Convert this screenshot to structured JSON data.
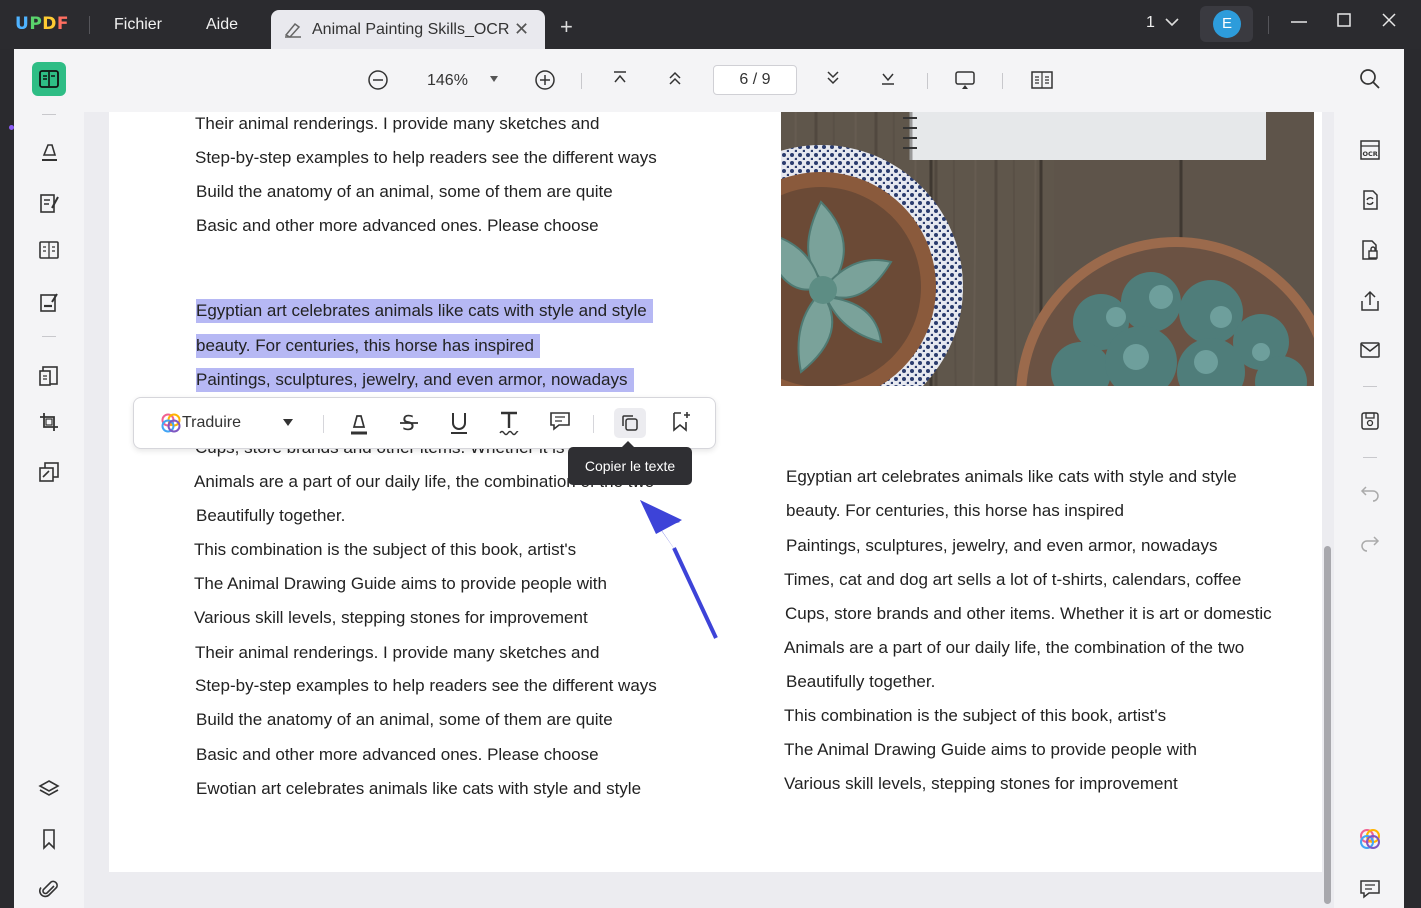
{
  "app": {
    "logo": {
      "u": "U",
      "p": "P",
      "d": "D",
      "f": "F"
    },
    "menus": [
      "Fichier",
      "Aide"
    ],
    "tab_title": "Animal Painting Skills_OCR",
    "page_selector": "1",
    "user_initial": "E"
  },
  "toolbar": {
    "zoom": "146%",
    "current_page": "6",
    "total_pages": "9",
    "page_display": "6 / 9"
  },
  "floating_toolbar": {
    "translate_label": "Traduire",
    "tooltip": "Copier le texte"
  },
  "document": {
    "left_column_top": [
      "Their animal renderings. I provide many sketches and",
      "Step-by-step examples to help readers see the different ways",
      "Build the anatomy of an animal, some of them are quite",
      "Basic and other more advanced ones. Please choose"
    ],
    "left_column_selected": [
      "Egyptian art celebrates animals like cats with style and style",
      "beauty. For centuries, this horse has inspired",
      "Paintings, sculptures, jewelry, and even armor, nowadays"
    ],
    "left_column_obscured": "Cups, store brands and other items. Whether it is art or domestic",
    "left_column_bottom": [
      "Animals are a part of our daily life, the combination of the two",
      "Beautifully together.",
      "This combination is the subject of this book, artist's",
      "The Animal Drawing Guide aims to provide people with",
      "Various skill levels, stepping stones for improvement",
      "Their animal renderings. I provide many sketches and",
      "Step-by-step examples to help readers see the different ways",
      "Build the anatomy of an animal, some of them are quite",
      "Basic and other more advanced ones. Please choose",
      "Ewotian art celebrates animals like cats with style and style"
    ],
    "right_column": [
      "Egyptian art celebrates animals like cats with style and style",
      "beauty. For centuries, this horse has inspired",
      "Paintings, sculptures, jewelry, and even armor, nowadays",
      "Times, cat and dog art sells a lot of t-shirts, calendars, coffee",
      "Cups, store brands and other items. Whether it is art or domestic",
      "Animals are a part of our daily life, the combination of the two",
      "Beautifully together.",
      "This combination is the subject of this book, artist's",
      "The Animal Drawing Guide aims to provide people with",
      "Various skill levels, stepping stones for improvement"
    ]
  },
  "colors": {
    "accent": "#2ebd85",
    "selection": "#b6b8f4",
    "annotation_arrow": "#3d43d8",
    "titlebar": "#2b2b2f"
  }
}
